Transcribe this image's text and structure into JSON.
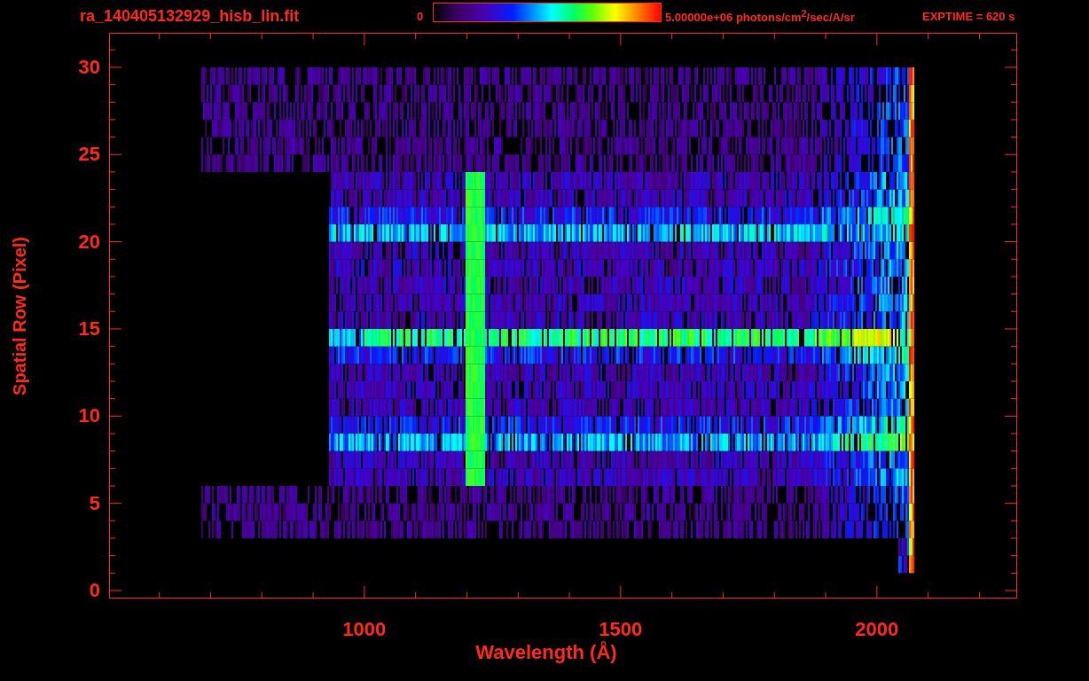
{
  "title": "ra_140405132929_hisb_lin.fit",
  "colorbar": {
    "min_label": "0",
    "max_label": "5.00000e+06 photons/cm$^{2}$/sec/A/sr"
  },
  "exposure": "EXPTIME = 620 s",
  "plot": {
    "ylabel": "Spatial Row (Pixel)",
    "xlabel": "Wavelength (Å)",
    "yticks": [
      "30",
      "25",
      "20",
      "15",
      "10",
      "5",
      "0"
    ],
    "xticks": [
      "1000",
      "1500",
      "2000"
    ]
  }
}
